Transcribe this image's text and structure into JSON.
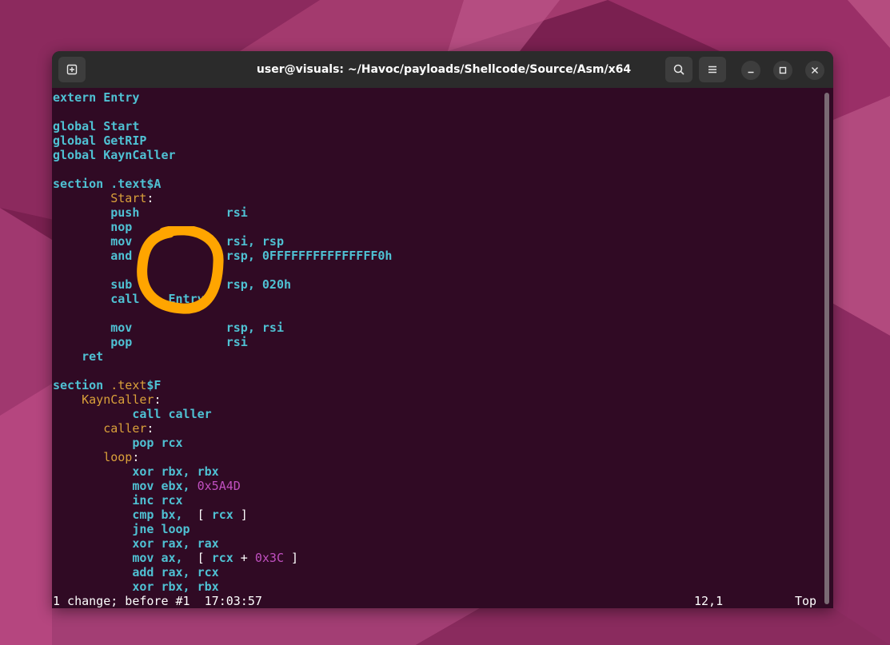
{
  "window": {
    "title": "user@visuals: ~/Havoc/payloads/Shellcode/Source/Asm/x64",
    "new_tab_icon": "new-tab-icon",
    "search_icon": "search-icon",
    "menu_icon": "hamburger-menu-icon",
    "minimize_icon": "minimize-icon",
    "maximize_icon": "maximize-icon",
    "close_icon": "close-icon"
  },
  "colors": {
    "background": "#300a24",
    "keyword": "#4fc1d3",
    "label": "#d9a03a",
    "number": "#c050c0",
    "text": "#ffffff",
    "annotation": "#ffa500"
  },
  "code": [
    [
      {
        "t": "extern Entry",
        "c": "kw"
      }
    ],
    [],
    [
      {
        "t": "global Start",
        "c": "kw"
      }
    ],
    [
      {
        "t": "global GetRIP",
        "c": "kw"
      }
    ],
    [
      {
        "t": "global KaynCaller",
        "c": "kw"
      }
    ],
    [],
    [
      {
        "t": "section .text$A",
        "c": "kw"
      }
    ],
    [
      {
        "t": "        ",
        "c": "txt"
      },
      {
        "t": "Start",
        "c": "lbl"
      },
      {
        "t": ":",
        "c": "txt"
      }
    ],
    [
      {
        "t": "        push            rsi",
        "c": "kw"
      }
    ],
    [
      {
        "t": "        nop",
        "c": "kw"
      }
    ],
    [
      {
        "t": "        mov             rsi, rsp",
        "c": "kw"
      }
    ],
    [
      {
        "t": "        and             rsp, 0FFFFFFFFFFFFFFF0h",
        "c": "kw"
      }
    ],
    [],
    [
      {
        "t": "        sub             rsp, 020h",
        "c": "kw"
      }
    ],
    [
      {
        "t": "        call    Entry",
        "c": "kw"
      }
    ],
    [],
    [
      {
        "t": "        mov             rsp, rsi",
        "c": "kw"
      }
    ],
    [
      {
        "t": "        pop             rsi",
        "c": "kw"
      }
    ],
    [
      {
        "t": "    ret",
        "c": "kw"
      }
    ],
    [],
    [
      {
        "t": "section ",
        "c": "kw"
      },
      {
        "t": ".text",
        "c": "lbl"
      },
      {
        "t": "$F",
        "c": "kw"
      }
    ],
    [
      {
        "t": "    ",
        "c": "txt"
      },
      {
        "t": "KaynCaller",
        "c": "lbl"
      },
      {
        "t": ":",
        "c": "txt"
      }
    ],
    [
      {
        "t": "           call caller",
        "c": "kw"
      }
    ],
    [
      {
        "t": "       ",
        "c": "txt"
      },
      {
        "t": "caller",
        "c": "lbl"
      },
      {
        "t": ":",
        "c": "txt"
      }
    ],
    [
      {
        "t": "           pop rcx",
        "c": "kw"
      }
    ],
    [
      {
        "t": "       ",
        "c": "txt"
      },
      {
        "t": "loop",
        "c": "lbl"
      },
      {
        "t": ":",
        "c": "txt"
      }
    ],
    [
      {
        "t": "           xor rbx, rbx",
        "c": "kw"
      }
    ],
    [
      {
        "t": "           mov ebx, ",
        "c": "kw"
      },
      {
        "t": "0x5A4D",
        "c": "num"
      }
    ],
    [
      {
        "t": "           inc rcx",
        "c": "kw"
      }
    ],
    [
      {
        "t": "           cmp bx, ",
        "c": "kw"
      },
      {
        "t": " [ ",
        "c": "txt"
      },
      {
        "t": "rcx",
        "c": "kw"
      },
      {
        "t": " ]",
        "c": "txt"
      }
    ],
    [
      {
        "t": "           jne loop",
        "c": "kw"
      }
    ],
    [
      {
        "t": "           xor rax, rax",
        "c": "kw"
      }
    ],
    [
      {
        "t": "           mov ax, ",
        "c": "kw"
      },
      {
        "t": " [ ",
        "c": "txt"
      },
      {
        "t": "rcx",
        "c": "kw"
      },
      {
        "t": " + ",
        "c": "txt"
      },
      {
        "t": "0x3C",
        "c": "num"
      },
      {
        "t": " ]",
        "c": "txt"
      }
    ],
    [
      {
        "t": "           add rax, rcx",
        "c": "kw"
      }
    ],
    [
      {
        "t": "           xor rbx, rbx",
        "c": "kw"
      }
    ]
  ],
  "status": {
    "message": "1 change; before #1  17:03:57",
    "position": "12,1",
    "scroll": "Top"
  }
}
